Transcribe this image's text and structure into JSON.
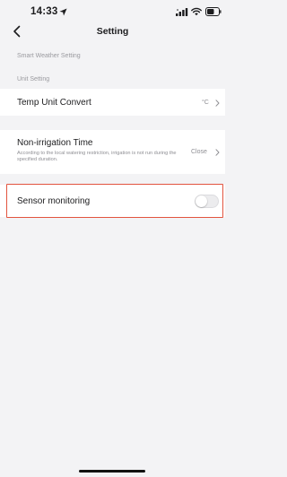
{
  "status_bar": {
    "time": "14:33",
    "icons": [
      "location-arrow-icon",
      "signal-icon",
      "wifi-icon",
      "battery-icon"
    ]
  },
  "nav": {
    "back_icon": "chevron-left-icon",
    "title": "Setting"
  },
  "sections": {
    "smart_weather": "Smart Weather Setting",
    "unit": "Unit Setting"
  },
  "temp_unit": {
    "label": "Temp Unit Convert",
    "value": "°C"
  },
  "non_irrigation": {
    "label": "Non-irrigation Time",
    "description": "According to the local watering restriction,   irrigation is not run during the specified duration.",
    "value": "Close"
  },
  "sensor_monitoring": {
    "label": "Sensor monitoring",
    "enabled": false
  },
  "colors": {
    "highlight_border": "#e2543f",
    "background": "#f3f3f5",
    "row_background": "#ffffff"
  }
}
